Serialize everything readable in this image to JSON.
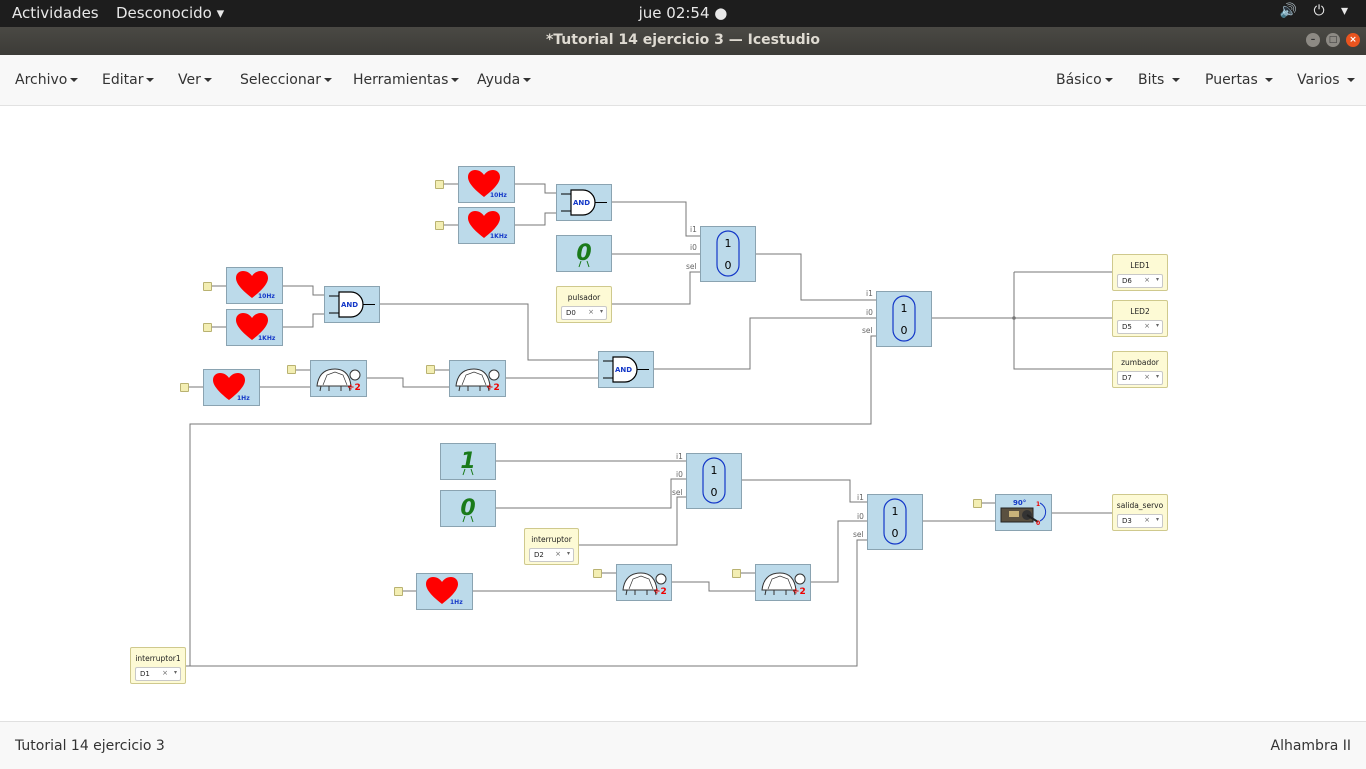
{
  "topbar": {
    "activities": "Actividades",
    "app_menu": "Desconocido",
    "clock": "jue 02:54 ●",
    "tray": "🔊 ⏻ ▾"
  },
  "window": {
    "title": "*Tutorial 14 ejercicio 3 — Icestudio"
  },
  "menus": {
    "left": [
      "Archivo",
      "Editar",
      "Ver",
      "Seleccionar",
      "Herramientas",
      "Ayuda"
    ],
    "right": [
      "Básico",
      "Bits",
      "Puertas",
      "Varios"
    ]
  },
  "blocks": {
    "freq": {
      "f10": "10Hz",
      "f1k": "1KHz",
      "f1": "1Hz"
    },
    "and_label": "AND",
    "div_label": "÷2",
    "const": {
      "zero": "0",
      "one": "1"
    },
    "mux": {
      "top": "1",
      "bottom": "0"
    },
    "servo": {
      "angle": "90°",
      "one": "1",
      "zero": "0"
    }
  },
  "ports": {
    "i1": "i1",
    "i0": "i0",
    "sel": "sel"
  },
  "io": {
    "pulsador": {
      "name": "pulsador",
      "pin": "D0"
    },
    "interruptor": {
      "name": "interruptor",
      "pin": "D2"
    },
    "interruptor1": {
      "name": "interruptor1",
      "pin": "D1"
    },
    "led1": {
      "name": "LED1",
      "pin": "D6"
    },
    "led2": {
      "name": "LED2",
      "pin": "D5"
    },
    "zumbador": {
      "name": "zumbador",
      "pin": "D7"
    },
    "salida_servo": {
      "name": "salida_servo",
      "pin": "D3"
    },
    "clear": "×",
    "arrow": "▾"
  },
  "statusbar": {
    "left": "Tutorial 14 ejercicio 3",
    "right": "Alhambra II"
  },
  "colors": {
    "block": "#bcdaea",
    "io": "#fdfad5",
    "heart": "#ff0000",
    "constant": "#1a7a1a",
    "and_text": "#1438c8"
  }
}
